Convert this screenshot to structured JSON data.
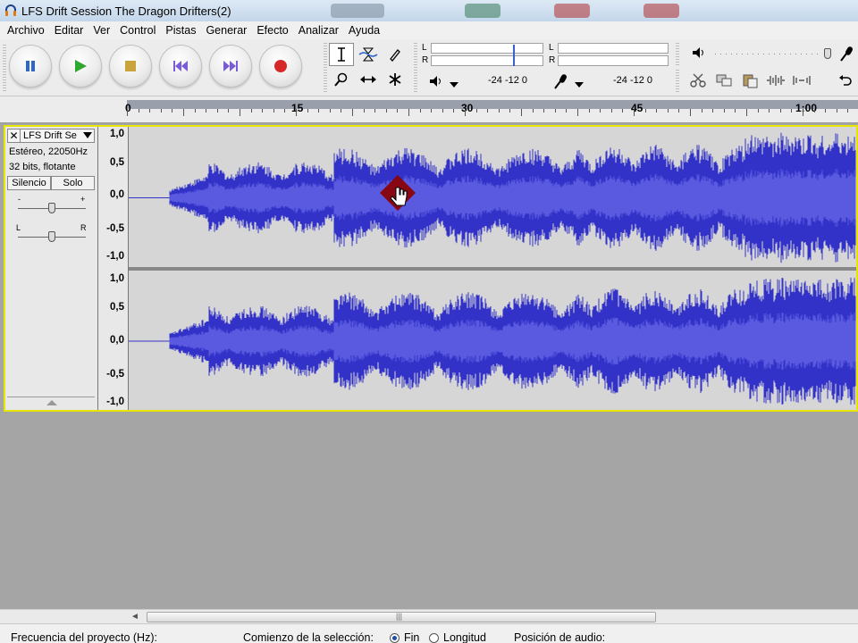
{
  "window": {
    "title": "LFS Drift Session The Dragon Drifters(2)"
  },
  "menu": [
    "Archivo",
    "Editar",
    "Ver",
    "Control",
    "Pistas",
    "Generar",
    "Efecto",
    "Analizar",
    "Ayuda"
  ],
  "meters": {
    "play_l": "L",
    "play_r": "R",
    "rec_l": "L",
    "rec_r": "R",
    "play_scale": "-24  -12  0",
    "rec_scale": "-24  -12  0"
  },
  "ruler": {
    "labels": [
      "0",
      "15",
      "30",
      "45",
      "1:00"
    ]
  },
  "track": {
    "name": "LFS Drift Se",
    "info_format": "Estéreo, 22050Hz",
    "info_bits": "32 bits, flotante",
    "mute_label": "Silencio",
    "solo_label": "Solo",
    "gain_minus": "-",
    "gain_plus": "+",
    "pan_left": "L",
    "pan_right": "R",
    "close_glyph": "✕",
    "scale_top": [
      "1,0",
      "0,5",
      "0,0",
      "-0,5",
      "-1,0"
    ],
    "scale_bottom": [
      "1,0",
      "0,5",
      "0,0",
      "-0,5",
      "-1,0"
    ]
  },
  "status": {
    "project_rate_label": "Frecuencia del proyecto (Hz):",
    "selection_start_label": "Comienzo de la selección:",
    "opt_end": "Fin",
    "opt_length": "Longitud",
    "audio_position_label": "Posición de audio:"
  },
  "colors": {
    "wave": "#3232c8",
    "wave_light": "#5a5ae0",
    "track_border": "#e6e600"
  }
}
